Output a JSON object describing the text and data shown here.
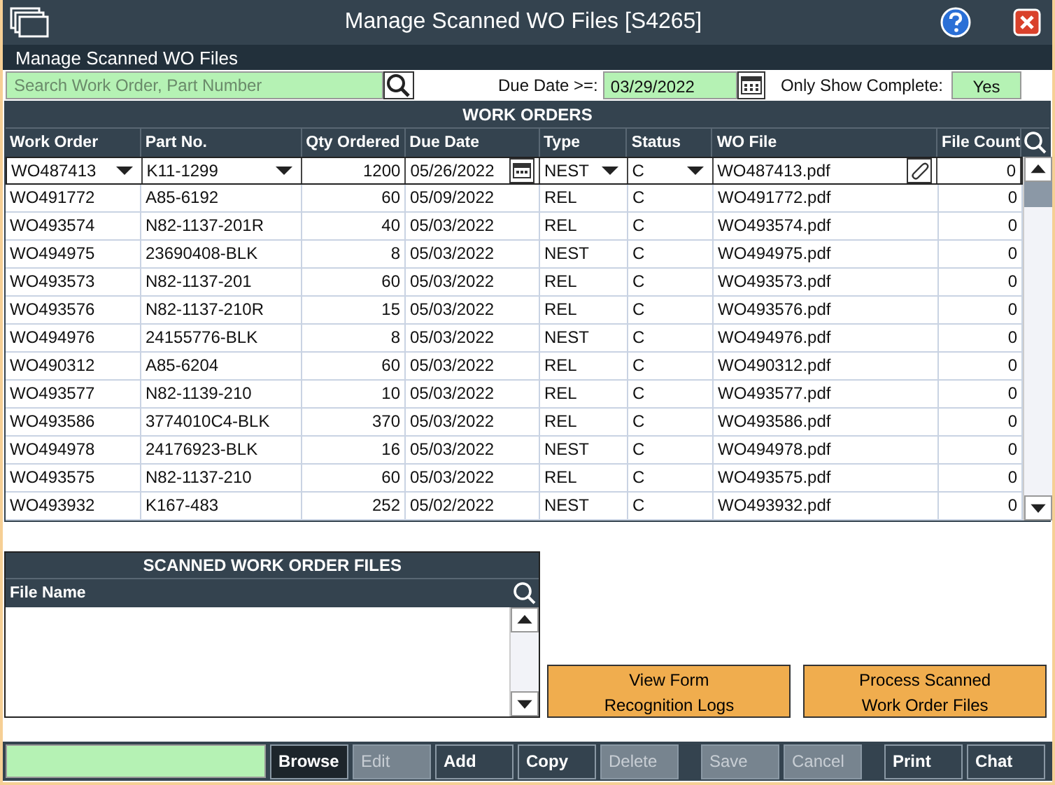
{
  "window": {
    "title": "Manage Scanned WO Files [S4265]"
  },
  "subtitle": "Manage Scanned WO Files",
  "filters": {
    "search_placeholder": "Search Work Order, Part Number",
    "due_label": "Due Date >=:",
    "due_value": "03/29/2022",
    "complete_label": "Only Show Complete:",
    "complete_value": "Yes"
  },
  "work_orders": {
    "title": "WORK ORDERS",
    "columns": [
      "Work Order",
      "Part No.",
      "Qty Ordered",
      "Due Date",
      "Type",
      "Status",
      "WO File",
      "File Count"
    ],
    "rows": [
      {
        "editing": true,
        "cells": [
          "WO487413",
          "K11-1299",
          "1200",
          "05/26/2022",
          "NEST",
          "C",
          "WO487413.pdf",
          "0"
        ]
      },
      {
        "editing": false,
        "cells": [
          "WO491772",
          "A85-6192",
          "60",
          "05/09/2022",
          "REL",
          "C",
          "WO491772.pdf",
          "0"
        ]
      },
      {
        "editing": false,
        "cells": [
          "WO493574",
          "N82-1137-201R",
          "40",
          "05/03/2022",
          "REL",
          "C",
          "WO493574.pdf",
          "0"
        ]
      },
      {
        "editing": false,
        "cells": [
          "WO494975",
          "23690408-BLK",
          "8",
          "05/03/2022",
          "NEST",
          "C",
          "WO494975.pdf",
          "0"
        ]
      },
      {
        "editing": false,
        "cells": [
          "WO493573",
          "N82-1137-201",
          "60",
          "05/03/2022",
          "REL",
          "C",
          "WO493573.pdf",
          "0"
        ]
      },
      {
        "editing": false,
        "cells": [
          "WO493576",
          "N82-1137-210R",
          "15",
          "05/03/2022",
          "REL",
          "C",
          "WO493576.pdf",
          "0"
        ]
      },
      {
        "editing": false,
        "cells": [
          "WO494976",
          "24155776-BLK",
          "8",
          "05/03/2022",
          "NEST",
          "C",
          "WO494976.pdf",
          "0"
        ]
      },
      {
        "editing": false,
        "cells": [
          "WO490312",
          "A85-6204",
          "60",
          "05/03/2022",
          "REL",
          "C",
          "WO490312.pdf",
          "0"
        ]
      },
      {
        "editing": false,
        "cells": [
          "WO493577",
          "N82-1139-210",
          "10",
          "05/03/2022",
          "REL",
          "C",
          "WO493577.pdf",
          "0"
        ]
      },
      {
        "editing": false,
        "cells": [
          "WO493586",
          "3774010C4-BLK",
          "370",
          "05/03/2022",
          "REL",
          "C",
          "WO493586.pdf",
          "0"
        ]
      },
      {
        "editing": false,
        "cells": [
          "WO494978",
          "24176923-BLK",
          "16",
          "05/03/2022",
          "NEST",
          "C",
          "WO494978.pdf",
          "0"
        ]
      },
      {
        "editing": false,
        "cells": [
          "WO493575",
          "N82-1137-210",
          "60",
          "05/03/2022",
          "REL",
          "C",
          "WO493575.pdf",
          "0"
        ]
      },
      {
        "editing": false,
        "cells": [
          "WO493932",
          "K167-483",
          "252",
          "05/02/2022",
          "NEST",
          "C",
          "WO493932.pdf",
          "0"
        ]
      }
    ]
  },
  "scanned_files": {
    "title": "SCANNED WORK ORDER FILES",
    "column": "File Name"
  },
  "actions": [
    "View Form\nRecognition Logs",
    "Process Scanned\nWork Order Files"
  ],
  "toolbar": [
    {
      "label": "Browse",
      "selected": true,
      "disabled": false
    },
    {
      "label": "Edit",
      "selected": false,
      "disabled": true
    },
    {
      "label": "Add",
      "selected": false,
      "disabled": false
    },
    {
      "label": "Copy",
      "selected": false,
      "disabled": false
    },
    {
      "label": "Delete",
      "selected": false,
      "disabled": true
    },
    {
      "label": "Save",
      "selected": false,
      "disabled": true
    },
    {
      "label": "Cancel",
      "selected": false,
      "disabled": true
    },
    {
      "label": "Print",
      "selected": false,
      "disabled": false
    },
    {
      "label": "Chat",
      "selected": false,
      "disabled": false
    }
  ]
}
